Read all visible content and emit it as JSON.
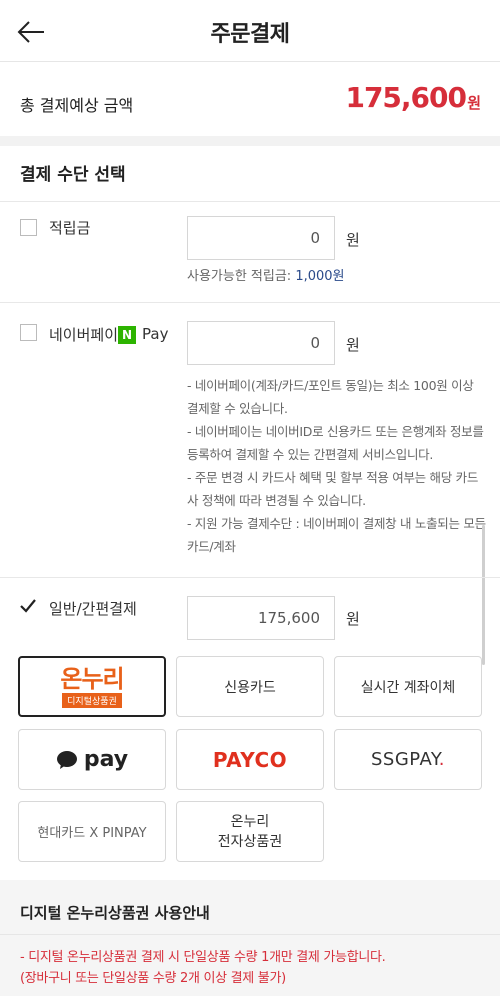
{
  "header": {
    "title": "주문결제"
  },
  "total": {
    "label": "총 결제예상 금액",
    "amount": "175,600",
    "unit": "원"
  },
  "section_title": "결제 수단 선택",
  "points": {
    "label": "적립금",
    "value": "0",
    "unit": "원",
    "available_label": "사용가능한 적립금:",
    "available_value": "1,000원"
  },
  "naverpay": {
    "label": "네이버페이",
    "badge": "N",
    "badge_text": "Pay",
    "value": "0",
    "unit": "원",
    "notes": [
      "- 네이버페이(계좌/카드/포인트 동일)는 최소 100원 이상 결제할 수 있습니다.",
      "- 네이버페이는 네이버ID로 신용카드 또는 은행계좌 정보를 등록하여 결제할 수 있는 간편결제 서비스입니다.",
      "- 주문 변경 시 카드사 혜택 및 할부 적용 여부는 해당 카드사 정책에 따라 변경될 수 있습니다.",
      "- 지원 가능 결제수단 : 네이버페이 결제창 내 노출되는 모든 카드/계좌"
    ]
  },
  "general": {
    "label": "일반/간편결제",
    "value": "175,600",
    "unit": "원",
    "checked": true
  },
  "methods": {
    "onnuri_logo": "온누리",
    "onnuri_sub": "디지털상품권",
    "credit_card": "신용카드",
    "bank_transfer": "실시간 계좌이체",
    "kakaopay": "pay",
    "payco": "PAYCO",
    "ssgpay_a": "SSG",
    "ssgpay_b": "PAY",
    "ssgpay_c": ".",
    "hyundai": "현대카드 X PINPAY",
    "onnuri_e_line1": "온누리",
    "onnuri_e_line2": "전자상품권"
  },
  "guide": {
    "title": "디지털 온누리상품권 사용안내",
    "line1": "- 디지털 온누리상품권 결제 시 단일상품 수량 1개만 결제 가능합니다.",
    "line2": "(장바구니 또는 단일상품 수량 2개 이상 결제 불가)"
  },
  "colors": {
    "accent_red": "#d62e3a",
    "naver_green": "#2db400",
    "onnuri_orange": "#e8611a"
  }
}
